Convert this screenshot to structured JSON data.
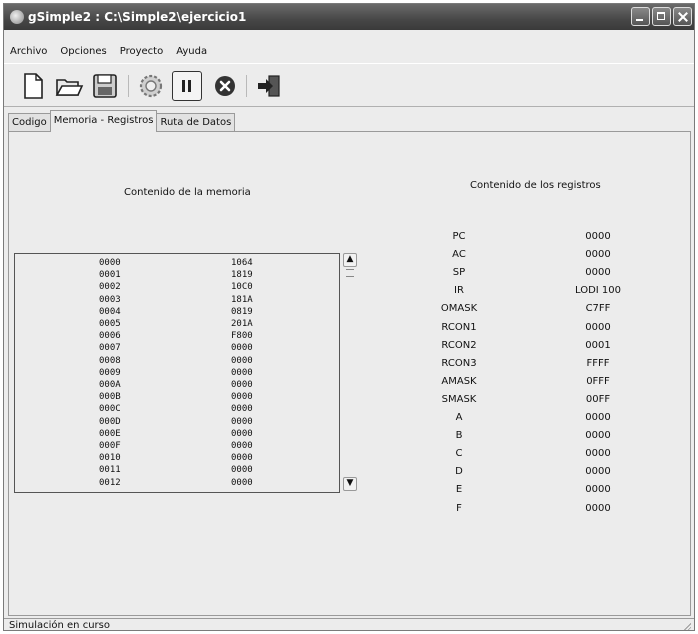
{
  "window": {
    "title": "gSimple2 : C:\\Simple2\\ejercicio1"
  },
  "menu": [
    {
      "label": "Archivo"
    },
    {
      "label": "Opciones"
    },
    {
      "label": "Proyecto"
    },
    {
      "label": "Ayuda"
    }
  ],
  "toolbar": {
    "buttons": [
      "new-file",
      "open-folder",
      "save-disk",
      "settings-gear",
      "pause",
      "stop",
      "exit"
    ]
  },
  "tabs": [
    {
      "label": "Codigo",
      "active": false
    },
    {
      "label": "Memoria - Registros",
      "active": true
    },
    {
      "label": "Ruta de Datos",
      "active": false
    }
  ],
  "memory": {
    "title": "Contenido de la memoria",
    "rows": [
      {
        "addr": "0000",
        "val": "1064"
      },
      {
        "addr": "0001",
        "val": "1819"
      },
      {
        "addr": "0002",
        "val": "10C0"
      },
      {
        "addr": "0003",
        "val": "181A"
      },
      {
        "addr": "0004",
        "val": "0819"
      },
      {
        "addr": "0005",
        "val": "201A"
      },
      {
        "addr": "0006",
        "val": "F800"
      },
      {
        "addr": "0007",
        "val": "0000"
      },
      {
        "addr": "0008",
        "val": "0000"
      },
      {
        "addr": "0009",
        "val": "0000"
      },
      {
        "addr": "000A",
        "val": "0000"
      },
      {
        "addr": "000B",
        "val": "0000"
      },
      {
        "addr": "000C",
        "val": "0000"
      },
      {
        "addr": "000D",
        "val": "0000"
      },
      {
        "addr": "000E",
        "val": "0000"
      },
      {
        "addr": "000F",
        "val": "0000"
      },
      {
        "addr": "0010",
        "val": "0000"
      },
      {
        "addr": "0011",
        "val": "0000"
      },
      {
        "addr": "0012",
        "val": "0000"
      }
    ]
  },
  "registers": {
    "title": "Contenido de los registros",
    "rows": [
      {
        "name": "PC",
        "val": "0000"
      },
      {
        "name": "AC",
        "val": "0000"
      },
      {
        "name": "SP",
        "val": "0000"
      },
      {
        "name": "IR",
        "val": "LODI 100"
      },
      {
        "name": "OMASK",
        "val": "C7FF"
      },
      {
        "name": "RCON1",
        "val": "0000"
      },
      {
        "name": "RCON2",
        "val": "0001"
      },
      {
        "name": "RCON3",
        "val": "FFFF"
      },
      {
        "name": "AMASK",
        "val": "0FFF"
      },
      {
        "name": "SMASK",
        "val": "00FF"
      },
      {
        "name": "A",
        "val": "0000"
      },
      {
        "name": "B",
        "val": "0000"
      },
      {
        "name": "C",
        "val": "0000"
      },
      {
        "name": "D",
        "val": "0000"
      },
      {
        "name": "E",
        "val": "0000"
      },
      {
        "name": "F",
        "val": "0000"
      }
    ]
  },
  "status": {
    "text": "Simulación en curso"
  }
}
